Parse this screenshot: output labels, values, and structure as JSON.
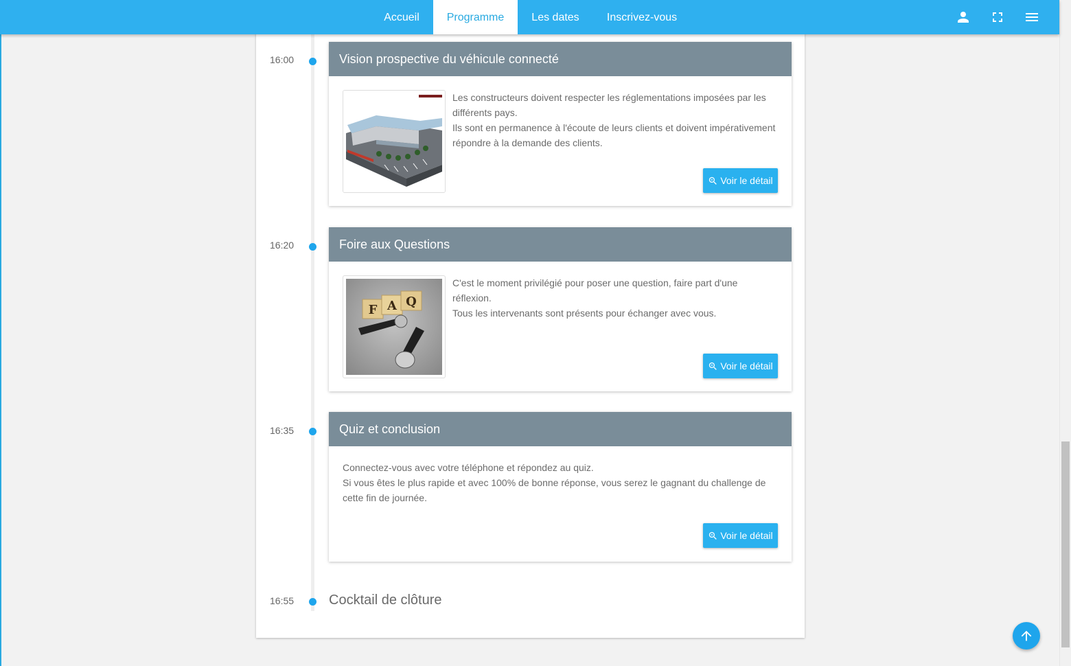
{
  "nav": {
    "items": [
      {
        "label": "Accueil",
        "active": false
      },
      {
        "label": "Programme",
        "active": true
      },
      {
        "label": "Les dates",
        "active": false
      },
      {
        "label": "Inscrivez-vous",
        "active": false
      }
    ],
    "icons": [
      "user-icon",
      "fullscreen-icon",
      "menu-icon"
    ]
  },
  "colors": {
    "navbar": "#2fb0ef",
    "accent": "#29aae1",
    "session_header": "#7a8d99",
    "button": "#2ab1ef"
  },
  "schedule": {
    "sessions": [
      {
        "time": "16:00",
        "title": "Vision prospective du véhicule connecté",
        "lines": [
          "Les constructeurs doivent respecter les réglementations imposées par les différents pays.",
          "Ils sont en permanence à l'écoute de leurs clients et doivent impérativement répondre à la demande des clients."
        ],
        "image_icon": "dealership-building-image",
        "button": "Voir le détail"
      },
      {
        "time": "16:20",
        "title": "Foire aux Questions",
        "lines": [
          "C'est le moment privilégié pour poser une question, faire part d'une réflexion.",
          "Tous les intervenants sont présents pour échanger avec vous."
        ],
        "image_icon": "faq-microphones-image",
        "image_text": "FAQ",
        "button": "Voir le détail"
      },
      {
        "time": "16:35",
        "title": "Quiz et conclusion",
        "lines": [
          "Connectez-vous avec votre téléphone et répondez au quiz.",
          "Si vous êtes le plus rapide et avec 100% de bonne réponse, vous serez le gagnant du challenge de cette fin de journée."
        ],
        "button": "Voir le détail"
      }
    ],
    "closing": {
      "time": "16:55",
      "title": "Cocktail de clôture"
    }
  }
}
